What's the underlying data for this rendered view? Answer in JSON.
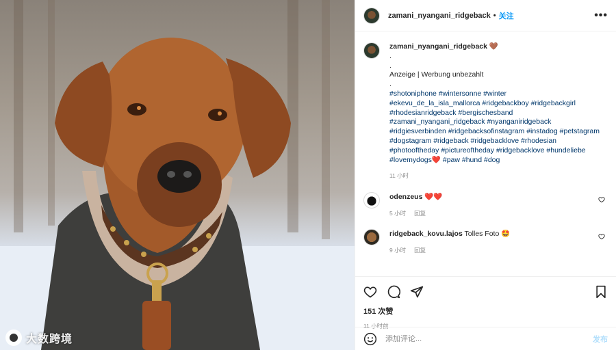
{
  "header": {
    "username": "zamani_nyangani_ridgeback",
    "separator": "•",
    "follow_label": "关注",
    "more_label": "•••"
  },
  "caption": {
    "username": "zamani_nyangani_ridgeback",
    "emoji": "🤎",
    "lines": [
      ".",
      ".",
      "Anzeige | Werbung unbezahlt",
      "."
    ],
    "hashtags": [
      "#shotoniphone #wintersonne #winter",
      "#ekevu_de_la_isla_mallorca #ridgebackboy #ridgebackgirl",
      "#rhodesianridgeback #bergischesband",
      "#zamani_nyangani_ridgeback #nyanganiridgeback",
      "#ridgiesverbinden #ridgebacksofinstagram #instadog #petstagram",
      "#dogstagram #ridgeback #ridgebacklove #rhodesian",
      "#photooftheday #pictureoftheday #ridgebacklove #hundeliebe",
      "#lovemydogs❤️ #paw #hund #dog"
    ],
    "time": "11 小时"
  },
  "comments": [
    {
      "username": "odenzeus",
      "text": "❤️❤️",
      "time": "5 小时",
      "reply": "回复"
    },
    {
      "username": "ridgeback_kovu.lajos",
      "text": "Tolles Foto 🤩",
      "time": "9 小时",
      "reply": "回复"
    }
  ],
  "likes": "151 次赞",
  "post_time": "11 小时前",
  "add_comment": {
    "placeholder": "添加评论...",
    "post_label": "发布"
  },
  "watermark": {
    "text": "大数跨境"
  },
  "icons": [
    "like-heart-icon",
    "comment-bubble-icon",
    "share-paper-plane-icon",
    "save-bookmark-icon",
    "emoji-smiley-icon",
    "more-dots-icon"
  ],
  "colors": {
    "link": "#0095f6",
    "hashtag": "#00376b",
    "muted": "#8e8e8e",
    "post_disabled": "#b2dffc"
  }
}
